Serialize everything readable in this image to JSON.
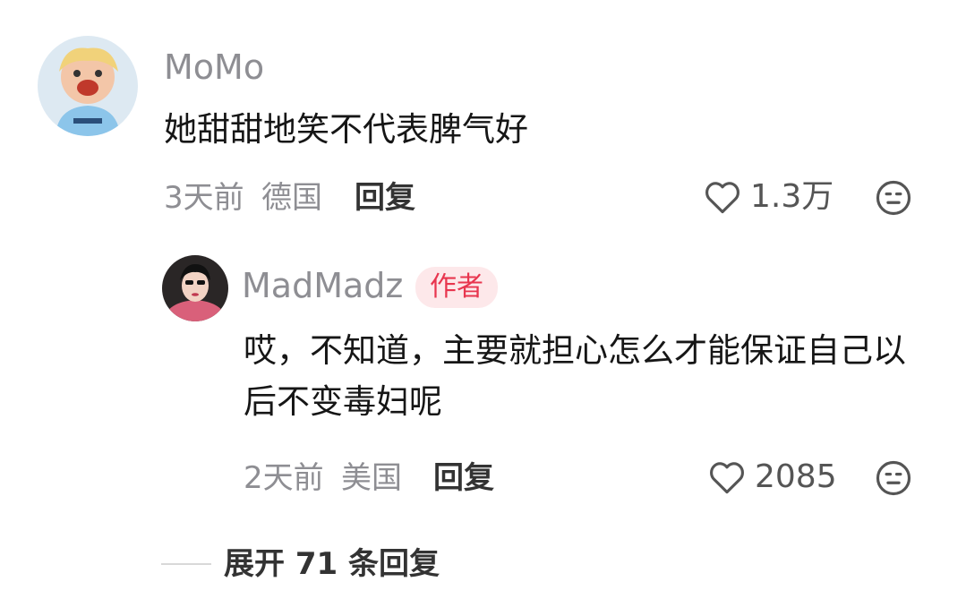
{
  "comment": {
    "username": "MoMo",
    "text": "她甜甜地笑不代表脾气好",
    "time": "3天前",
    "location": "德国",
    "reply_label": "回复",
    "likes": "1.3万"
  },
  "reply": {
    "username": "MadMadz",
    "badge": "作者",
    "text": "哎，不知道，主要就担心怎么才能保证自己以后不变毒妇呢",
    "time": "2天前",
    "location": "美国",
    "reply_label": "回复",
    "likes": "2085"
  },
  "expand_label": "展开 71 条回复",
  "colors": {
    "muted": "#8e8e93",
    "badge_bg": "#fde8ea",
    "badge_text": "#e8364f"
  },
  "icons": {
    "like": "heart-outline-icon",
    "dislike": "neutral-face-icon",
    "divider": "dash-line"
  }
}
